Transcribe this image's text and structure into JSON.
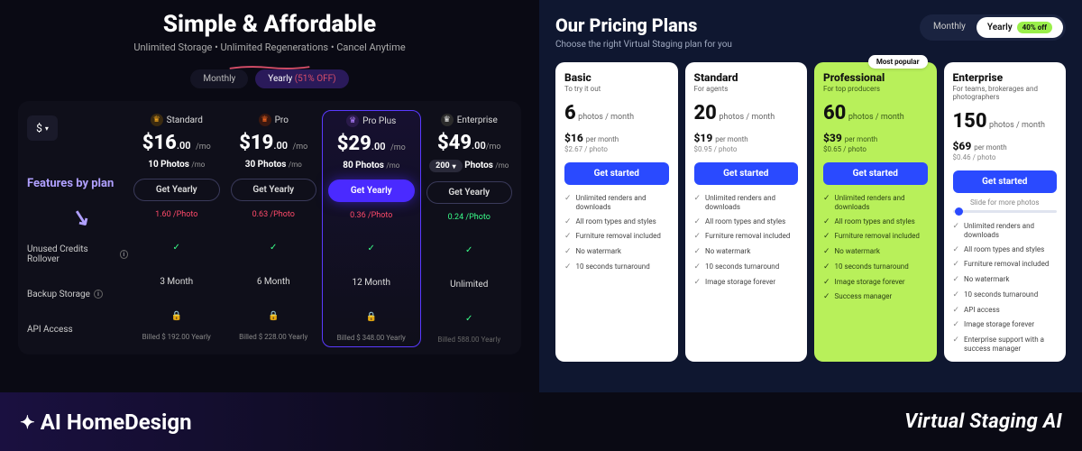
{
  "left": {
    "title": "Simple & Affordable",
    "subtitle": "Unlimited Storage • Unlimited Regenerations • Cancel Anytime",
    "toggle": {
      "monthly": "Monthly",
      "yearly": "Yearly",
      "yearly_off": "(51% OFF)"
    },
    "currency": "$",
    "feat_header": "Features by plan",
    "feat_rows": [
      "Unused Credits Rollover",
      "Backup Storage",
      "API Access"
    ],
    "plans": [
      {
        "name": "Standard",
        "price": "$16",
        "cents": ".00",
        "per": "/mo",
        "photos": "10 Photos",
        "photos_per": "/mo",
        "cta": "Get Yearly",
        "per_photo": "1.60 /Photo",
        "pp_cls": "r",
        "rollover": "check",
        "backup": "3 Month",
        "api": "lock",
        "billed": "Billed $ 192.00 Yearly"
      },
      {
        "name": "Pro",
        "price": "$19",
        "cents": ".00",
        "per": "/mo",
        "photos": "30 Photos",
        "photos_per": "/mo",
        "cta": "Get Yearly",
        "per_photo": "0.63 /Photo",
        "pp_cls": "r",
        "rollover": "check",
        "backup": "6 Month",
        "api": "lock",
        "billed": "Billed $ 228.00 Yearly"
      },
      {
        "name": "Pro Plus",
        "price": "$29",
        "cents": ".00",
        "per": "/mo",
        "photos": "80 Photos",
        "photos_per": "/mo",
        "cta": "Get Yearly",
        "per_photo": "0.36 /Photo",
        "pp_cls": "r",
        "rollover": "check",
        "backup": "12 Month",
        "api": "lock",
        "billed": "Billed $ 348.00 Yearly"
      },
      {
        "name": "Enterprise",
        "price": "$49",
        "cents": ".00",
        "per": "/mo",
        "photos_sel": "200",
        "photos_label": "Photos",
        "photos_per": "/mo",
        "cta": "Get Yearly",
        "per_photo": "0.24 /Photo",
        "pp_cls": "g",
        "rollover": "check",
        "backup": "Unlimited",
        "api": "check",
        "billed": "Billed 588.00 Yearly"
      }
    ]
  },
  "right": {
    "title": "Our Pricing Plans",
    "subtitle": "Choose the right Virtual Staging plan for you",
    "toggle": {
      "monthly": "Monthly",
      "yearly": "Yearly",
      "off": "40% off"
    },
    "popular": "Most popular",
    "cta": "Get started",
    "slide_hint": "Slide for more photos",
    "photos_unit": "photos / month",
    "per_month": "per month",
    "plans": [
      {
        "name": "Basic",
        "tag": "To try it out",
        "photos": "6",
        "price": "$16",
        "pp": "$2.67 / photo",
        "feats": [
          "Unlimited renders and downloads",
          "All room types and styles",
          "Furniture removal included",
          "No watermark",
          "10 seconds turnaround"
        ]
      },
      {
        "name": "Standard",
        "tag": "For agents",
        "photos": "20",
        "price": "$19",
        "pp": "$0.95 / photo",
        "feats": [
          "Unlimited renders and downloads",
          "All room types and styles",
          "Furniture removal included",
          "No watermark",
          "10 seconds turnaround",
          "Image storage forever"
        ]
      },
      {
        "name": "Professional",
        "tag": "For top producers",
        "photos": "60",
        "price": "$39",
        "pp": "$0.65 / photo",
        "feats": [
          "Unlimited renders and downloads",
          "All room types and styles",
          "Furniture removal included",
          "No watermark",
          "10 seconds turnaround",
          "Image storage forever",
          "Success manager"
        ]
      },
      {
        "name": "Enterprise",
        "tag": "For teams, brokerages and photographers",
        "photos": "150",
        "price": "$69",
        "pp": "$0.46 / photo",
        "slider": true,
        "feats": [
          "Unlimited renders and downloads",
          "All room types and styles",
          "Furniture removal included",
          "No watermark",
          "10 seconds turnaround",
          "API access",
          "Image storage forever",
          "Enterprise support with a success manager"
        ]
      }
    ]
  },
  "footer": {
    "left": "AI HomeDesign",
    "right": "Virtual Staging AI"
  }
}
